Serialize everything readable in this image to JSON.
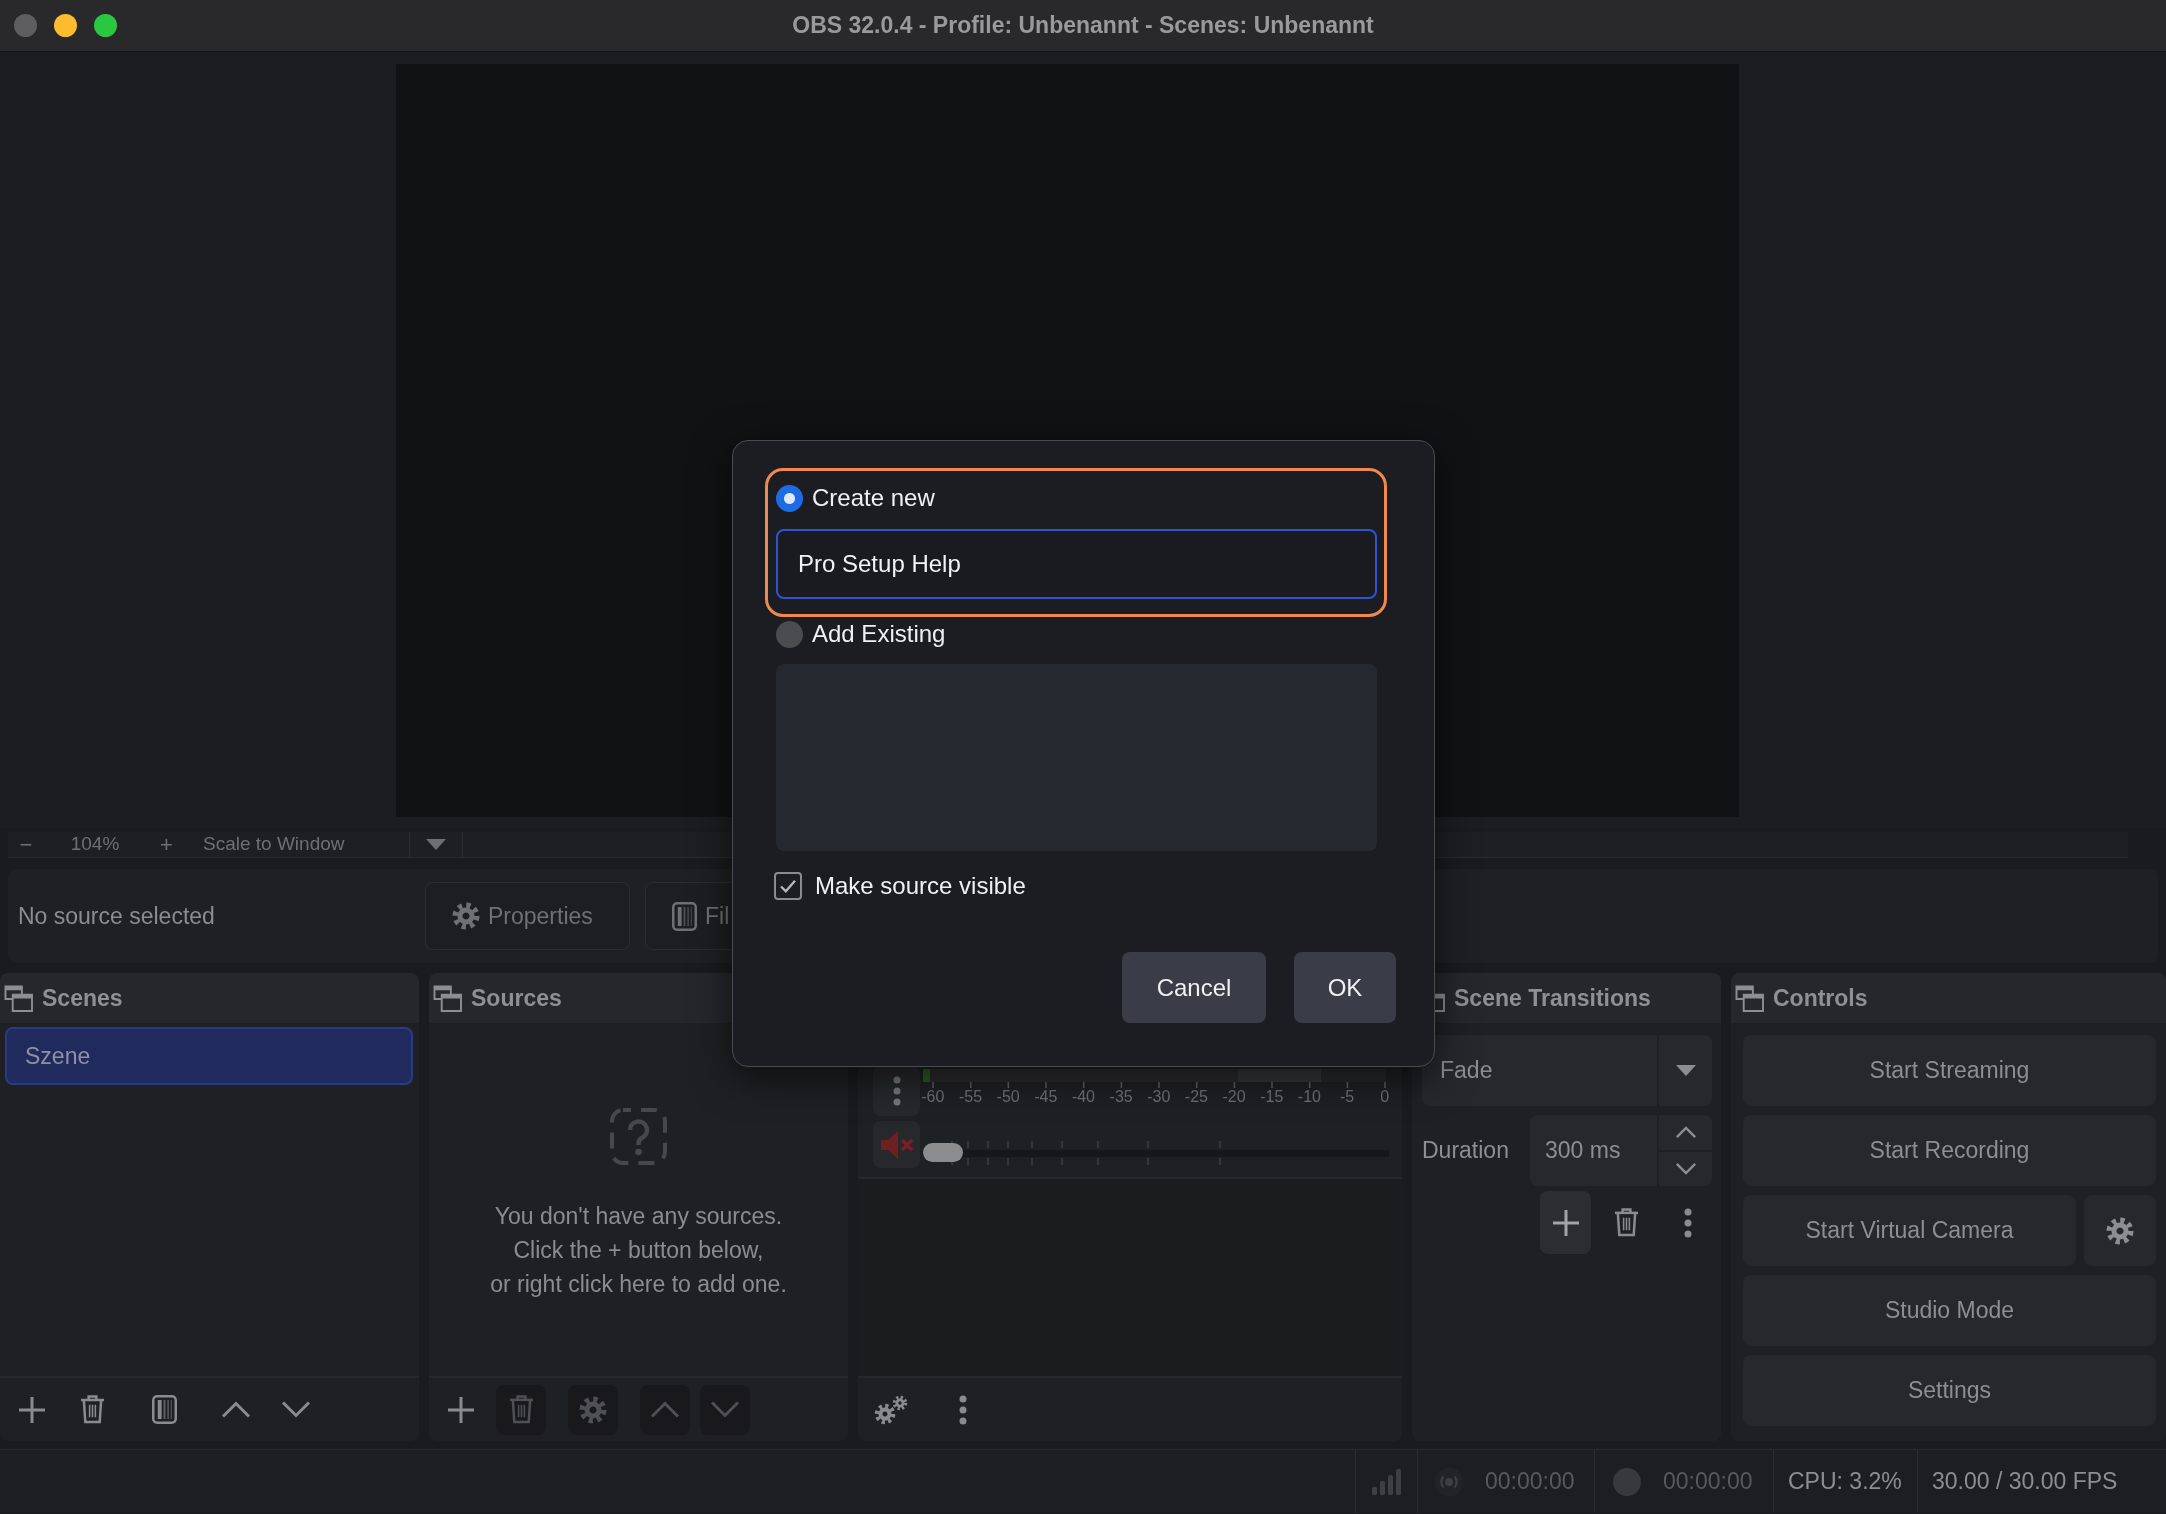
{
  "window": {
    "title": "OBS 32.0.4 - Profile: Unbenannt - Scenes: Unbenannt",
    "controls": [
      {
        "color": "#5e5e60"
      },
      {
        "color": "#fdbc2f"
      },
      {
        "color": "#2ac840"
      }
    ]
  },
  "preview_bar": {
    "zoom_out": "−",
    "zoom": "104%",
    "zoom_in": "+",
    "scale_mode": "Scale to Window"
  },
  "context_bar": {
    "status": "No source selected",
    "buttons": [
      {
        "kind": "properties",
        "label": "Properties"
      },
      {
        "kind": "filters",
        "label": "Fil"
      }
    ]
  },
  "scenes": {
    "title": "Scenes",
    "items": [
      {
        "label": "Szene",
        "selected": true
      }
    ],
    "toolbar": [
      {
        "kind": "add",
        "disabled": false
      },
      {
        "kind": "remove",
        "disabled": false
      },
      {
        "kind": "filters",
        "disabled": false
      },
      {
        "kind": "up",
        "disabled": false
      },
      {
        "kind": "down",
        "disabled": false
      }
    ]
  },
  "sources": {
    "title": "Sources",
    "empty_message": "You don't have any sources.\nClick the + button below,\nor right click here to add one.",
    "toolbar": [
      {
        "kind": "add",
        "disabled": false
      },
      {
        "kind": "remove",
        "disabled": true
      },
      {
        "kind": "properties",
        "disabled": true
      },
      {
        "kind": "up",
        "disabled": true
      },
      {
        "kind": "down",
        "disabled": true
      }
    ]
  },
  "audio_mixer": {
    "meter": {
      "level": 0.015,
      "scale": [
        "-60",
        "-55",
        "-50",
        "-45",
        "-40",
        "-35",
        "-30",
        "-25",
        "-20",
        "-15",
        "-10",
        "-5",
        "0"
      ]
    },
    "muted": true,
    "volume": {
      "level": 0
    },
    "toolbar": [
      {
        "kind": "advanced"
      },
      {
        "kind": "menu"
      }
    ]
  },
  "scene_transitions": {
    "title": "Scene Transitions",
    "transition": "Fade",
    "duration_label": "Duration",
    "duration": "300 ms",
    "toolbar": [
      {
        "kind": "add",
        "hovered": true
      },
      {
        "kind": "remove",
        "hovered": false
      },
      {
        "kind": "menu",
        "hovered": false
      }
    ]
  },
  "controls": {
    "title": "Controls",
    "buttons": [
      {
        "label": "Start Streaming",
        "has_settings": false
      },
      {
        "label": "Start Recording",
        "has_settings": false
      },
      {
        "label": "Start Virtual Camera",
        "has_settings": true
      },
      {
        "label": "Studio Mode",
        "has_settings": false
      },
      {
        "label": "Settings",
        "has_settings": false
      }
    ]
  },
  "status_bar": {
    "streaming": false,
    "stream_time": "00:00:00",
    "recording": false,
    "record_time": "00:00:00",
    "cpu": "CPU: 3.2%",
    "fps": "30.00 / 30.00 FPS"
  },
  "dialog": {
    "options": [
      {
        "kind": "create",
        "label": "Create new",
        "selected": true,
        "highlighted": true
      },
      {
        "kind": "existing",
        "label": "Add Existing",
        "selected": false,
        "highlighted": false
      }
    ],
    "name_field": {
      "value": "Pro Setup Help"
    },
    "visibility": {
      "label": "Make source visible",
      "checked": true
    },
    "buttons": [
      {
        "kind": "cancel",
        "label": "Cancel"
      },
      {
        "kind": "ok",
        "label": "OK"
      }
    ]
  }
}
